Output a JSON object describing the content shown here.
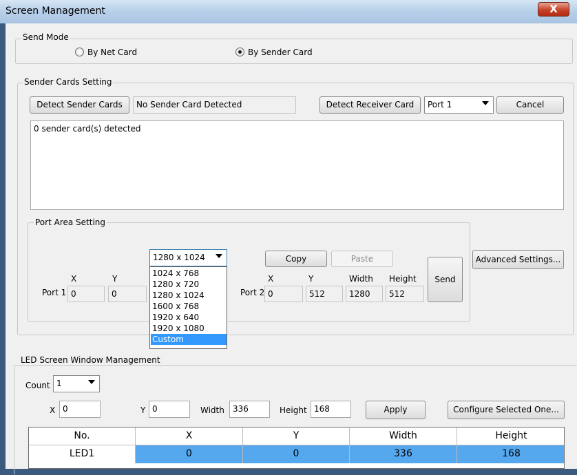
{
  "window": {
    "title": "Screen Management",
    "close_glyph": "X"
  },
  "send_mode": {
    "title": "Send Mode",
    "options": [
      {
        "label": "By Net Card",
        "selected": false
      },
      {
        "label": "By Sender Card",
        "selected": true
      }
    ]
  },
  "sender_cards": {
    "title": "Sender Cards Setting",
    "detect_sender_label": "Detect Sender Cards",
    "status_text": "No Sender Card Detected",
    "detect_receiver_label": "Detect Receiver Card",
    "port_value": "Port 1",
    "cancel_label": "Cancel",
    "log_text": "0 sender card(s) detected"
  },
  "port_area": {
    "title": "Port Area Setting",
    "resolution_value": "1280 x 1024",
    "resolution_options": [
      "1024 x 768",
      "1280 x 720",
      "1280 x 1024",
      "1600 x 768",
      "1920 x 640",
      "1920 x 1080",
      "Custom"
    ],
    "resolution_highlighted": "Custom",
    "copy_label": "Copy",
    "paste_label": "Paste",
    "send_label": "Send",
    "advanced_label": "Advanced Settings...",
    "port1": {
      "label": "Port 1",
      "x_label": "X",
      "y_label": "Y",
      "x": "0",
      "y": "0"
    },
    "port2": {
      "label": "Port 2",
      "x_label": "X",
      "y_label": "Y",
      "width_label": "Width",
      "height_label": "Height",
      "x": "0",
      "y": "512",
      "width": "1280",
      "height": "512"
    }
  },
  "led_window": {
    "title": "LED Screen Window Management",
    "count_label": "Count",
    "count_value": "1",
    "x_label": "X",
    "x_value": "0",
    "y_label": "Y",
    "y_value": "0",
    "width_label": "Width",
    "width_value": "336",
    "height_label": "Height",
    "height_value": "168",
    "apply_label": "Apply",
    "configure_label": "Configure Selected One...",
    "table": {
      "columns": [
        "No.",
        "X",
        "Y",
        "Width",
        "Height"
      ],
      "rows": [
        [
          "LED1",
          "0",
          "0",
          "336",
          "168"
        ]
      ],
      "selected_row_color": "#55a7ee"
    }
  },
  "colors": {
    "selection": "#3399ff",
    "close_button": "#c7432a"
  }
}
